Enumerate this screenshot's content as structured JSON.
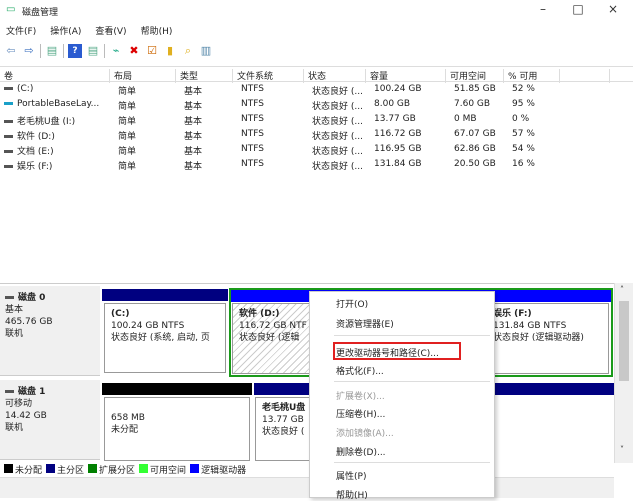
{
  "window": {
    "title": "磁盘管理",
    "minimize": "–",
    "maximize": "□",
    "close": "×"
  },
  "menu": [
    "文件(F)",
    "操作(A)",
    "查看(V)",
    "帮助(H)"
  ],
  "toolbar": [
    "back-icon",
    "forward-icon",
    "console-icon",
    "help-icon",
    "properties-icon",
    "connect-icon",
    "delete-icon",
    "check-icon",
    "up-icon",
    "search-icon",
    "list-icon"
  ],
  "table": {
    "headers": [
      "卷",
      "布局",
      "类型",
      "文件系统",
      "状态",
      "容量",
      "可用空间",
      "% 可用"
    ],
    "rows": [
      [
        "(C:)",
        "简单",
        "基本",
        "NTFS",
        "状态良好 (...",
        "100.24 GB",
        "51.85 GB",
        "52 %"
      ],
      [
        "PortableBaseLay...",
        "简单",
        "基本",
        "NTFS",
        "状态良好 (...",
        "8.00 GB",
        "7.60 GB",
        "95 %"
      ],
      [
        "老毛桃U盘 (I:)",
        "简单",
        "基本",
        "NTFS",
        "状态良好 (...",
        "13.77 GB",
        "0 MB",
        "0 %"
      ],
      [
        "软件 (D:)",
        "简单",
        "基本",
        "NTFS",
        "状态良好 (...",
        "116.72 GB",
        "67.07 GB",
        "57 %"
      ],
      [
        "文档 (E:)",
        "简单",
        "基本",
        "NTFS",
        "状态良好 (...",
        "116.95 GB",
        "62.86 GB",
        "54 %"
      ],
      [
        "娱乐 (F:)",
        "简单",
        "基本",
        "NTFS",
        "状态良好 (...",
        "131.84 GB",
        "20.50 GB",
        "16 %"
      ]
    ]
  },
  "disks": [
    {
      "name": "磁盘 0",
      "type": "基本",
      "size": "465.76 GB",
      "status": "联机",
      "parts": [
        {
          "name": "(C:)",
          "size": "100.24 GB NTFS",
          "status": "状态良好 (系统, 启动, 页"
        },
        {
          "name": "软件  (D:)",
          "size": "116.72 GB NTF",
          "status": "状态良好 (逻辑"
        },
        {
          "name": "娱乐  (F:)",
          "size": "131.84 GB NTFS",
          "status": "状态良好 (逻辑驱动器)"
        }
      ]
    },
    {
      "name": "磁盘 1",
      "type": "可移动",
      "size": "14.42 GB",
      "status": "联机",
      "parts": [
        {
          "size": "658 MB",
          "status": "未分配"
        },
        {
          "name": "老毛桃U盘",
          "size": "13.77 GB",
          "status": "状态良好 ("
        }
      ]
    }
  ],
  "legend": [
    {
      "label": "未分配",
      "color": "#000000"
    },
    {
      "label": "主分区",
      "color": "#000080"
    },
    {
      "label": "扩展分区",
      "color": "#008000"
    },
    {
      "label": "可用空间",
      "color": "#33ff33"
    },
    {
      "label": "逻辑驱动器",
      "color": "#0000ff"
    }
  ],
  "context_menu": [
    {
      "label": "打开(O)"
    },
    {
      "label": "资源管理器(E)"
    },
    {
      "label": "更改驱动器号和路径(C)...",
      "highlighted": true
    },
    {
      "label": "格式化(F)..."
    },
    {
      "label": "扩展卷(X)...",
      "disabled": true
    },
    {
      "label": "压缩卷(H)..."
    },
    {
      "label": "添加镜像(A)...",
      "disabled": true
    },
    {
      "label": "删除卷(D)..."
    },
    {
      "label": "属性(P)"
    },
    {
      "label": "帮助(H)"
    }
  ]
}
